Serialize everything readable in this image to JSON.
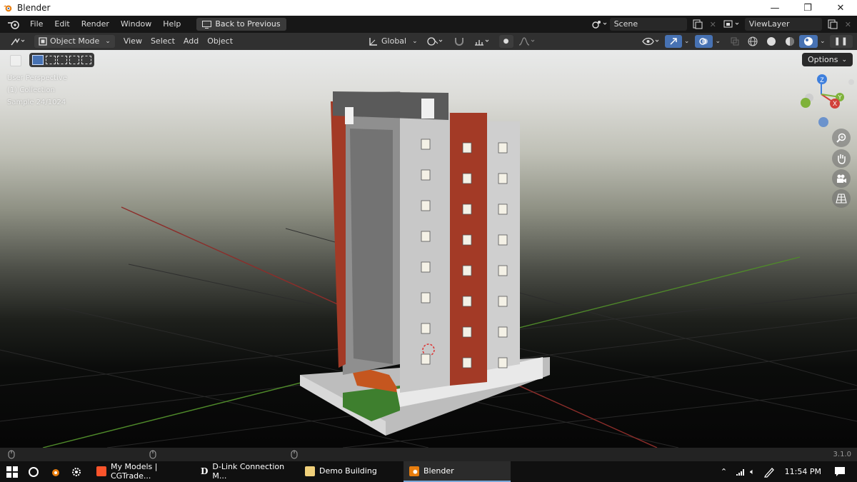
{
  "window": {
    "title": "Blender",
    "minimize": "—",
    "restore": "❐",
    "close": "✕"
  },
  "menu": {
    "items": [
      "File",
      "Edit",
      "Render",
      "Window",
      "Help"
    ],
    "back_button": "Back to Previous",
    "scene": "Scene",
    "view_layer": "ViewLayer"
  },
  "header": {
    "mode": "Object Mode",
    "menus": [
      "View",
      "Select",
      "Add",
      "Object"
    ],
    "orientation": "Global"
  },
  "viewport": {
    "perspective": "User Perspective",
    "collection": "(1) Collection",
    "sample": "Sample 24/1024",
    "options": "Options",
    "gizmo": {
      "z": "Z",
      "y": "Y",
      "x": "X"
    }
  },
  "status": {
    "version": "3.1.0"
  },
  "taskbar": {
    "tasks": [
      {
        "label": "My Models | CGTrade...",
        "icon": "brave-icon"
      },
      {
        "label": "D-Link Connection M...",
        "icon": "dlink-icon"
      },
      {
        "label": "Demo Building",
        "icon": "folder-icon"
      },
      {
        "label": "Blender",
        "icon": "blender-icon"
      }
    ],
    "time": "11:54 PM"
  },
  "colors": {
    "accent": "#4772b3",
    "brick": "#a33a26",
    "axis_x": "#d1413a",
    "axis_y": "#7fb23a",
    "axis_z": "#3e7fdd"
  }
}
